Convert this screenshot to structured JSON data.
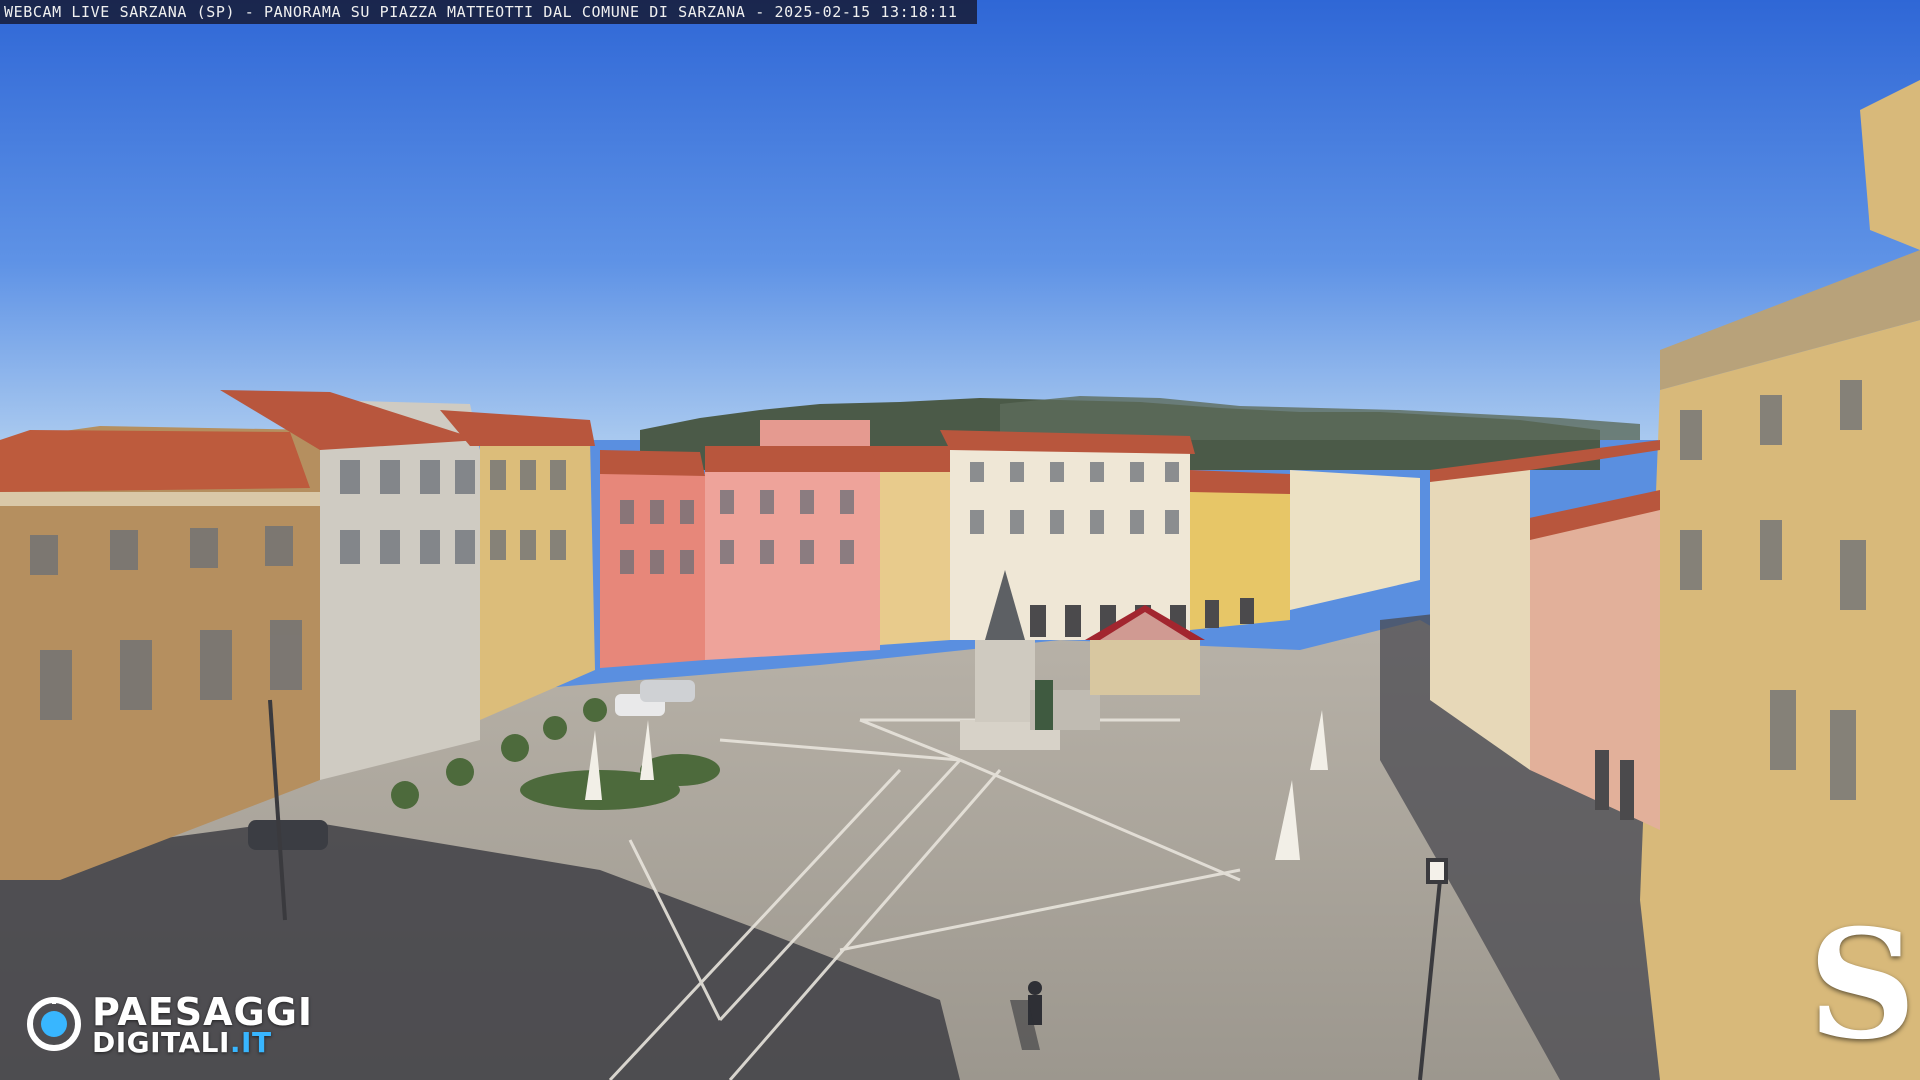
{
  "overlay": {
    "caption": "WEBCAM LIVE SARZANA (SP) - PANORAMA SU PIAZZA MATTEOTTI DAL COMUNE DI SARZANA - 2025-02-15  13:18:11"
  },
  "watermark_left": {
    "word1": "PAESAGGI",
    "word2_main": "DIGITALI",
    "word2_accent": ".IT",
    "icon": "eye-icon"
  },
  "watermark_right": {
    "letter": "S"
  },
  "colors": {
    "sky_top": "#3f78dc",
    "sky_bottom": "#9ec2ee",
    "pavement": "#a9a49c",
    "shadow": "#3f3f45",
    "roof": "#b9583f",
    "logo_accent": "#38b6ff"
  }
}
